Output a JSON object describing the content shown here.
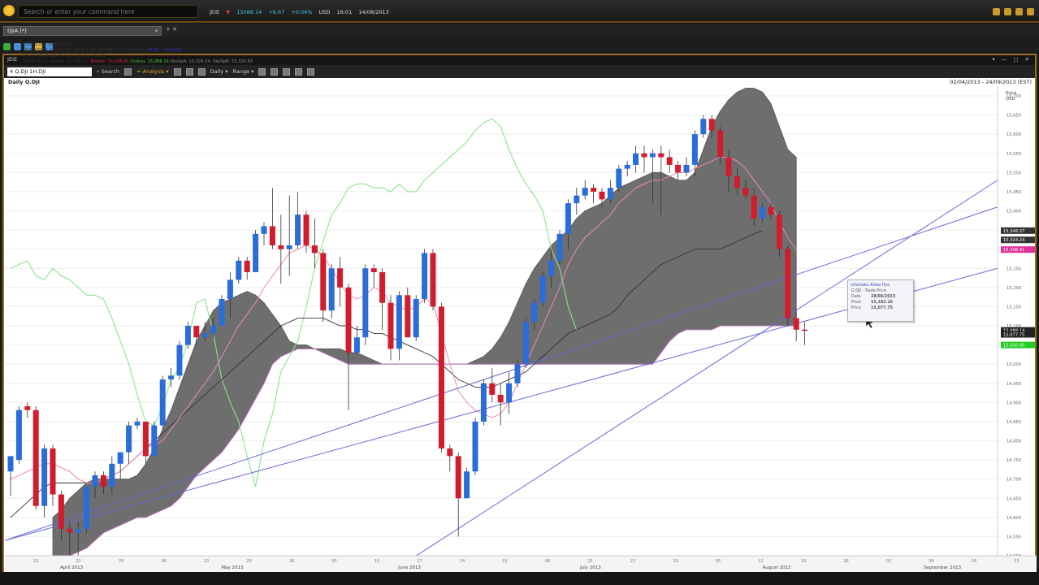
{
  "command_bar": {
    "placeholder": "Search or enter your command here"
  },
  "ticker": {
    "symbol": "JEIE",
    "price": "15088.14",
    "change": "+6.67",
    "pct": "+0.04%",
    "ccy": "USD",
    "time": "16:01",
    "date": "14/08/2013"
  },
  "tab": {
    "label": "DJIA [*]"
  },
  "window": {
    "title": "JEIE"
  },
  "chart_toolbar": {
    "symbol_value": "4 Q.DJI 1H.DJI",
    "search": "Search",
    "analysis": "Analysis",
    "interval": "Daily",
    "range_label": "Range"
  },
  "chart_title": "Daily Q.DJI",
  "date_range": "02/04/2013 - 24/09/2013 (EST)",
  "legend": {
    "line1": "Chrt, Q.DJI, Trade Price",
    "line2": "15/08/2013, 15,076.75, 15,100.79, 15,048.71, 15,088.14, ",
    "line2_change": "+8.67, (+0.06%)",
    "line3": "Ich, Q.DJI, Trade Price,  9, 26, 52, 26, 26",
    "line4": "18/08/2013, Kinbar: 15,348.37, ",
    "line4_tenkan": "Tenkan: 15,298.91",
    "line4_chikou": "Chikou: 15,088.14",
    "line4_senkou": "SkoSpA: 15,324.24, SkoSpB: 15,324.83"
  },
  "tooltip": {
    "title": "Ichimoku Kinko Hyo",
    "subtitle": "Q.DJI - Trade Price",
    "rows": [
      {
        "k": "Date",
        "v": "28/08/2013"
      },
      {
        "k": "Price",
        "v": "15,182.16"
      },
      {
        "k": "Price",
        "v": "15,077.75"
      }
    ]
  },
  "chart_data": {
    "type": "candlestick",
    "price_axis_label": "Price",
    "price_axis_unit": "USD",
    "y_ticks": [
      "15,700",
      "15,650",
      "15,600",
      "15,550",
      "15,500",
      "15,450",
      "15,400",
      "15,350",
      "15,300",
      "15,250",
      "15,200",
      "15,150",
      "15,100",
      "15,050",
      "15,000",
      "14,950",
      "14,900",
      "14,850",
      "14,800",
      "14,750",
      "14,700",
      "14,650",
      "14,600",
      "14,550",
      "14,500"
    ],
    "price_tags": [
      {
        "value": 15348.37,
        "label": "15,348.37",
        "color": "#333333"
      },
      {
        "value": 15324.24,
        "label": "15,324.24",
        "color": "#333333"
      },
      {
        "value": 15298.91,
        "label": "15,298.91",
        "color": "#e0309a"
      },
      {
        "value": 15088.14,
        "label": "15,088.14",
        "color": "#222222"
      },
      {
        "value": 15077.75,
        "label": "15,077.75",
        "color": "#222222"
      },
      {
        "value": 15050.0,
        "label": "15,050.00",
        "color": "#22cc22"
      }
    ],
    "x_day_ticks": [
      "15",
      "22",
      "29",
      "06",
      "13",
      "20",
      "28",
      "03",
      "10",
      "17",
      "24",
      "01",
      "08",
      "15",
      "22",
      "29",
      "05",
      "12",
      "19",
      "26",
      "02",
      "09",
      "16",
      "23"
    ],
    "x_months": [
      "April 2013",
      "May 2013",
      "June 2013",
      "July 2013",
      "August 2013",
      "September 2013"
    ],
    "candles": [
      [
        14720,
        14760,
        14760,
        14655
      ],
      [
        14750,
        14880,
        14890,
        14740
      ],
      [
        14890,
        14880,
        14900,
        14860
      ],
      [
        14880,
        14630,
        14890,
        14620
      ],
      [
        14630,
        14780,
        14790,
        14600
      ],
      [
        14780,
        14660,
        14790,
        14630
      ],
      [
        14660,
        14570,
        14670,
        14540
      ],
      [
        14570,
        14560,
        14590,
        14500
      ],
      [
        14560,
        14570,
        14590,
        14500
      ],
      [
        14570,
        14680,
        14680,
        14560
      ],
      [
        14680,
        14710,
        14720,
        14650
      ],
      [
        14710,
        14680,
        14720,
        14660
      ],
      [
        14680,
        14740,
        14760,
        14660
      ],
      [
        14740,
        14770,
        14770,
        14700
      ],
      [
        14770,
        14840,
        14850,
        14740
      ],
      [
        14840,
        14850,
        14860,
        14830
      ],
      [
        14850,
        14760,
        14850,
        14740
      ],
      [
        14760,
        14840,
        14850,
        14760
      ],
      [
        14840,
        14960,
        14970,
        14830
      ],
      [
        14960,
        14970,
        14990,
        14940
      ],
      [
        14970,
        15050,
        15060,
        14960
      ],
      [
        15050,
        15100,
        15110,
        15040
      ],
      [
        15100,
        15070,
        15100,
        15050
      ],
      [
        15070,
        15080,
        15110,
        15060
      ],
      [
        15080,
        15100,
        15120,
        15070
      ],
      [
        15100,
        15170,
        15180,
        15100
      ],
      [
        15170,
        15220,
        15240,
        15120
      ],
      [
        15220,
        15270,
        15280,
        15210
      ],
      [
        15270,
        15240,
        15280,
        15220
      ],
      [
        15240,
        15340,
        15350,
        15240
      ],
      [
        15340,
        15360,
        15370,
        15310
      ],
      [
        15360,
        15310,
        15460,
        15300
      ],
      [
        15310,
        15300,
        15390,
        15210
      ],
      [
        15300,
        15310,
        15440,
        15230
      ],
      [
        15310,
        15390,
        15450,
        15300
      ],
      [
        15390,
        15310,
        15400,
        15290
      ],
      [
        15310,
        15290,
        15380,
        15250
      ],
      [
        15290,
        15140,
        15300,
        15110
      ],
      [
        15140,
        15250,
        15260,
        15120
      ],
      [
        15250,
        15200,
        15280,
        15150
      ],
      [
        15200,
        15030,
        15210,
        14880
      ],
      [
        15030,
        15070,
        15100,
        15040
      ],
      [
        15070,
        15250,
        15260,
        15050
      ],
      [
        15250,
        15240,
        15260,
        15200
      ],
      [
        15240,
        15160,
        15250,
        15090
      ],
      [
        15160,
        15040,
        15180,
        15010
      ],
      [
        15040,
        15180,
        15190,
        15010
      ],
      [
        15180,
        15070,
        15200,
        15070
      ],
      [
        15070,
        15170,
        15180,
        15060
      ],
      [
        15170,
        15290,
        15300,
        15160
      ],
      [
        15290,
        15150,
        15300,
        15140
      ],
      [
        15150,
        14780,
        15160,
        14770
      ],
      [
        14780,
        14760,
        14790,
        14720
      ],
      [
        14760,
        14650,
        14770,
        14550
      ],
      [
        14650,
        14720,
        14730,
        14650
      ],
      [
        14720,
        14850,
        14860,
        14710
      ],
      [
        14850,
        14950,
        14960,
        14840
      ],
      [
        14950,
        14920,
        14990,
        14900
      ],
      [
        14920,
        14900,
        14950,
        14840
      ],
      [
        14900,
        14950,
        14980,
        14870
      ],
      [
        14950,
        15000,
        15010,
        14940
      ],
      [
        15000,
        15110,
        15120,
        14990
      ],
      [
        15110,
        15160,
        15170,
        15090
      ],
      [
        15160,
        15230,
        15240,
        15150
      ],
      [
        15230,
        15270,
        15300,
        15200
      ],
      [
        15270,
        15340,
        15350,
        15260
      ],
      [
        15340,
        15420,
        15430,
        15300
      ],
      [
        15420,
        15440,
        15460,
        15390
      ],
      [
        15440,
        15460,
        15480,
        15430
      ],
      [
        15460,
        15450,
        15470,
        15420
      ],
      [
        15450,
        15430,
        15460,
        15410
      ],
      [
        15430,
        15460,
        15480,
        15420
      ],
      [
        15460,
        15510,
        15520,
        15450
      ],
      [
        15510,
        15520,
        15530,
        15490
      ],
      [
        15520,
        15550,
        15570,
        15500
      ],
      [
        15550,
        15540,
        15570,
        15500
      ],
      [
        15540,
        15550,
        15560,
        15420
      ],
      [
        15550,
        15540,
        15570,
        15390
      ],
      [
        15540,
        15520,
        15560,
        15500
      ],
      [
        15520,
        15500,
        15530,
        15480
      ],
      [
        15500,
        15520,
        15540,
        15490
      ],
      [
        15520,
        15600,
        15610,
        15490
      ],
      [
        15600,
        15640,
        15650,
        15590
      ],
      [
        15640,
        15610,
        15650,
        15590
      ],
      [
        15610,
        15540,
        15620,
        15520
      ],
      [
        15540,
        15490,
        15560,
        15450
      ],
      [
        15490,
        15460,
        15510,
        15440
      ],
      [
        15460,
        15440,
        15480,
        15430
      ],
      [
        15440,
        15380,
        15460,
        15360
      ],
      [
        15380,
        15410,
        15420,
        15370
      ],
      [
        15410,
        15390,
        15420,
        15380
      ],
      [
        15390,
        15300,
        15400,
        15280
      ],
      [
        15300,
        15120,
        15310,
        15100
      ],
      [
        15120,
        15090,
        15140,
        15060
      ],
      [
        15090,
        15088,
        15110,
        15050
      ]
    ],
    "tenkan": [
      14700,
      14710,
      14720,
      14730,
      14740,
      14740,
      14730,
      14720,
      14700,
      14690,
      14690,
      14700,
      14710,
      14720,
      14740,
      14760,
      14780,
      14790,
      14800,
      14830,
      14860,
      14890,
      14920,
      14950,
      14980,
      15020,
      15060,
      15100,
      15130,
      15160,
      15200,
      15230,
      15260,
      15290,
      15300,
      15310,
      15300,
      15280,
      15250,
      15210,
      15180,
      15170,
      15180,
      15200,
      15190,
      15160,
      15150,
      15140,
      15150,
      15170,
      15160,
      15080,
      15000,
      14930,
      14900,
      14880,
      14870,
      14860,
      14870,
      14900,
      14950,
      15000,
      15050,
      15100,
      15150,
      15200,
      15260,
      15300,
      15330,
      15350,
      15370,
      15390,
      15420,
      15440,
      15460,
      15470,
      15480,
      15480,
      15490,
      15500,
      15500,
      15510,
      15520,
      15530,
      15540,
      15540,
      15530,
      15510,
      15480,
      15450,
      15420,
      15370,
      15330,
      15299
    ],
    "kijun": [
      14600,
      14620,
      14640,
      14660,
      14680,
      14690,
      14690,
      14690,
      14690,
      14690,
      14690,
      14700,
      14710,
      14720,
      14740,
      14760,
      14780,
      14800,
      14820,
      14840,
      14860,
      14880,
      14900,
      14920,
      14940,
      14960,
      14980,
      15000,
      15020,
      15040,
      15060,
      15080,
      15100,
      15110,
      15120,
      15120,
      15120,
      15120,
      15110,
      15100,
      15100,
      15090,
      15090,
      15080,
      15080,
      15070,
      15060,
      15050,
      15040,
      15030,
      15020,
      15000,
      14980,
      14960,
      14950,
      14940,
      14940,
      14940,
      14950,
      14960,
      14970,
      14980,
      15000,
      15020,
      15040,
      15060,
      15080,
      15090,
      15100,
      15110,
      15120,
      15130,
      15150,
      15180,
      15200,
      15220,
      15240,
      15260,
      15270,
      15280,
      15290,
      15300,
      15300,
      15300,
      15300,
      15310,
      15320,
      15330,
      15340,
      15348
    ],
    "chikou": [
      15250,
      15260,
      15270,
      15230,
      15220,
      15250,
      15230,
      15220,
      15200,
      15180,
      15180,
      15170,
      15120,
      15060,
      15000,
      14920,
      14850,
      14840,
      14890,
      14960,
      14990,
      15060,
      15160,
      15170,
      15080,
      14960,
      14900,
      14850,
      14760,
      14680,
      14800,
      14870,
      14980,
      15020,
      15060,
      15150,
      15250,
      15320,
      15390,
      15420,
      15460,
      15470,
      15470,
      15460,
      15460,
      15450,
      15470,
      15450,
      15450,
      15480,
      15500,
      15520,
      15540,
      15560,
      15580,
      15610,
      15630,
      15640,
      15620,
      15560,
      15510,
      15470,
      15440,
      15400,
      15300,
      15250,
      15150,
      15088
    ],
    "senkou_a": [
      14600,
      14620,
      14650,
      14670,
      14690,
      14700,
      14700,
      14700,
      14700,
      14700,
      14710,
      14740,
      14780,
      14830,
      14880,
      14940,
      15000,
      15060,
      15100,
      15140,
      15160,
      15170,
      15180,
      15190,
      15180,
      15160,
      15130,
      15100,
      15060,
      15050,
      15050,
      15040,
      15040,
      15040,
      15040,
      15030,
      15030,
      15020,
      15010,
      15000,
      15000,
      15000,
      15000,
      15000,
      15000,
      15000,
      15000,
      15000,
      15000,
      15000,
      15010,
      15020,
      15040,
      15070,
      15110,
      15160,
      15210,
      15250,
      15280,
      15310,
      15330,
      15350,
      15380,
      15400,
      15410,
      15420,
      15440,
      15460,
      15470,
      15480,
      15490,
      15500,
      15500,
      15490,
      15480,
      15480,
      15500,
      15560,
      15620,
      15660,
      15690,
      15710,
      15720,
      15720,
      15710,
      15680,
      15620,
      15560,
      15540
    ],
    "senkou_b": [
      14500,
      14500,
      14500,
      14510,
      14520,
      14540,
      14560,
      14570,
      14580,
      14590,
      14600,
      14600,
      14610,
      14620,
      14630,
      14650,
      14680,
      14710,
      14730,
      14750,
      14770,
      14800,
      14830,
      14870,
      14910,
      14950,
      15000,
      15020,
      15030,
      15040,
      15040,
      15040,
      15030,
      15020,
      15010,
      15000,
      15000,
      15000,
      15000,
      15000,
      15000,
      15000,
      15000,
      15000,
      15000,
      15000,
      15000,
      15000,
      15000,
      15000,
      15000,
      15000,
      15000,
      15000,
      15000,
      15000,
      15000,
      15000,
      15000,
      15000,
      15000,
      15000,
      15000,
      15000,
      15000,
      15000,
      15000,
      15000,
      15000,
      15000,
      15000,
      15000,
      15030,
      15060,
      15080,
      15090,
      15090,
      15090,
      15090,
      15100,
      15100,
      15100,
      15100,
      15100,
      15100,
      15100,
      15100,
      15100,
      15100
    ],
    "trendlines": [
      {
        "from": [
          "14 Apr 2013",
          14540
        ],
        "to": [
          "24 Sep 2013",
          15410
        ]
      },
      {
        "from": [
          "14 Apr 2013",
          14540
        ],
        "to": [
          "24 Sep 2013",
          15250
        ]
      },
      {
        "from": [
          "02 Jun 2013",
          14400
        ],
        "to": [
          "24 Sep 2013",
          15480
        ]
      }
    ]
  }
}
